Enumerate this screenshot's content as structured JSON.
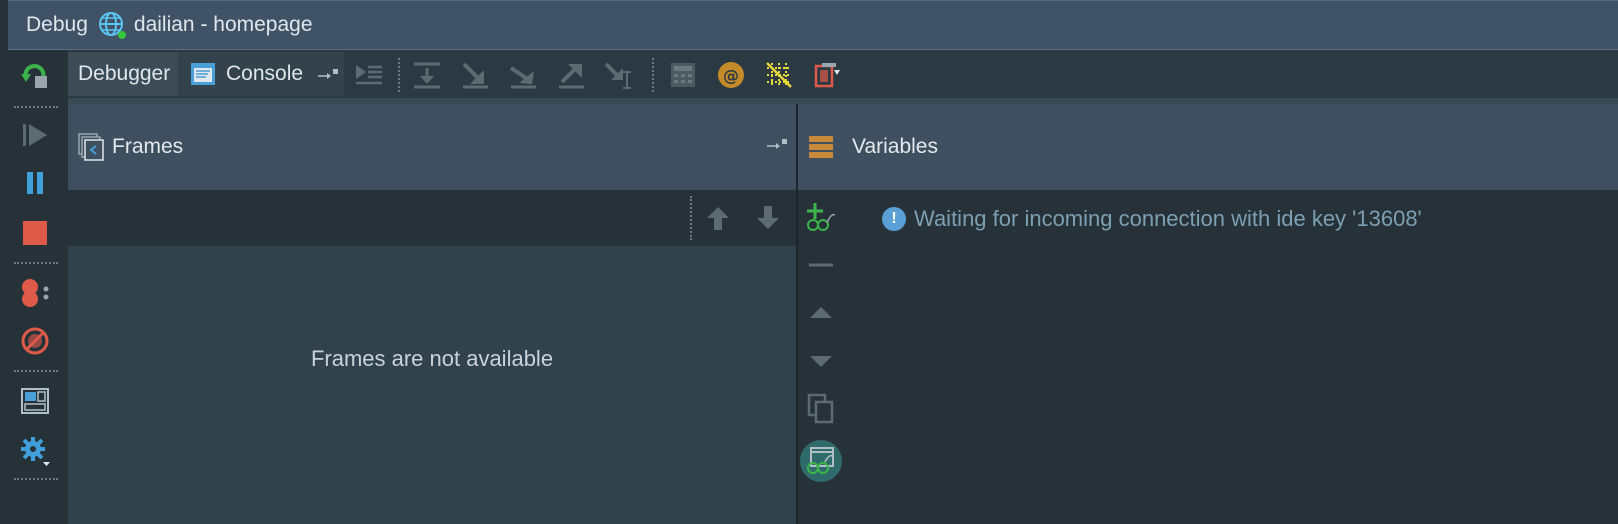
{
  "window": {
    "app_label": "Debug",
    "config_name": "dailian - homepage"
  },
  "tabs": [
    {
      "label": "Debugger",
      "active": true
    },
    {
      "label": "Console",
      "active": false
    }
  ],
  "frames": {
    "title": "Frames",
    "empty_message": "Frames are not available"
  },
  "variables": {
    "title": "Variables",
    "status_message": "Waiting for incoming connection with ide key '13608'"
  },
  "colors": {
    "titlebar": "#3f5266",
    "panel_header": "#3e4f60",
    "background": "#263238",
    "frames_body": "#32424c",
    "status_text": "#7d9fb3",
    "rerun_green": "#3cb44b",
    "stop_red": "#e05a4a",
    "pause_blue": "#3fa0dc"
  }
}
